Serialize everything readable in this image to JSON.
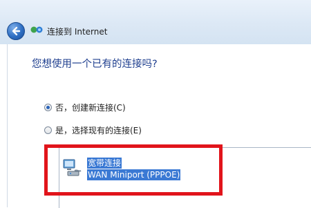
{
  "window": {
    "title": "连接到 Internet",
    "icons": {
      "back": "back-arrow-icon",
      "network": "network-globe-icon"
    }
  },
  "main": {
    "question": "您想使用一个已有的连接吗?",
    "options": [
      {
        "label": "否，创建新连接(C)",
        "checked": true
      },
      {
        "label": "是，选择现有的连接(E)",
        "checked": false
      }
    ],
    "connection": {
      "name": "宽带连接",
      "device": "WAN Miniport (PPPOE)",
      "icon": "broadband-connection-icon"
    }
  },
  "colors": {
    "accent": "#1f3f8f",
    "selection": "#3a79d4",
    "highlight_box": "#e1141b"
  }
}
